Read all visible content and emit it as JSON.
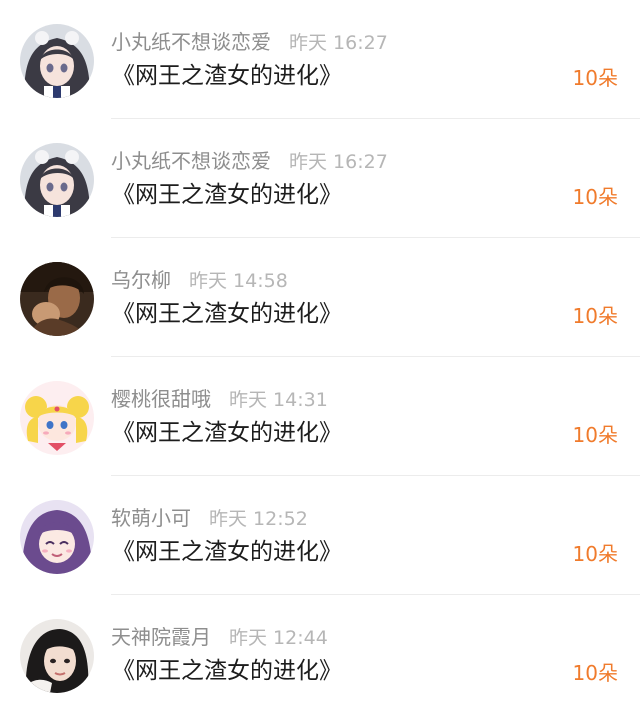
{
  "colors": {
    "accent": "#f07b2c",
    "username": "#8e8e8e",
    "timestamp": "#b6b6b6",
    "title": "#1d1d1d",
    "divider": "#ececec"
  },
  "gifts": [
    {
      "username": "小丸纸不想谈恋爱",
      "time": "昨天 16:27",
      "title": "《网王之渣女的进化》",
      "amount": "10朵",
      "avatar_icon": "anime-girl-bun-hair-avatar"
    },
    {
      "username": "小丸纸不想谈恋爱",
      "time": "昨天 16:27",
      "title": "《网王之渣女的进化》",
      "amount": "10朵",
      "avatar_icon": "anime-girl-bun-hair-avatar"
    },
    {
      "username": "乌尔柳",
      "time": "昨天 14:58",
      "title": "《网王之渣女的进化》",
      "amount": "10朵",
      "avatar_icon": "dark-photo-avatar"
    },
    {
      "username": "樱桃很甜哦",
      "time": "昨天 14:31",
      "title": "《网王之渣女的进化》",
      "amount": "10朵",
      "avatar_icon": "sailor-moon-avatar"
    },
    {
      "username": "软萌小可",
      "time": "昨天 12:52",
      "title": "《网王之渣女的进化》",
      "amount": "10朵",
      "avatar_icon": "purple-hair-anime-avatar"
    },
    {
      "username": "天神院霞月",
      "time": "昨天 12:44",
      "title": "《网王之渣女的进化》",
      "amount": "10朵",
      "avatar_icon": "girl-selfie-avatar"
    }
  ]
}
